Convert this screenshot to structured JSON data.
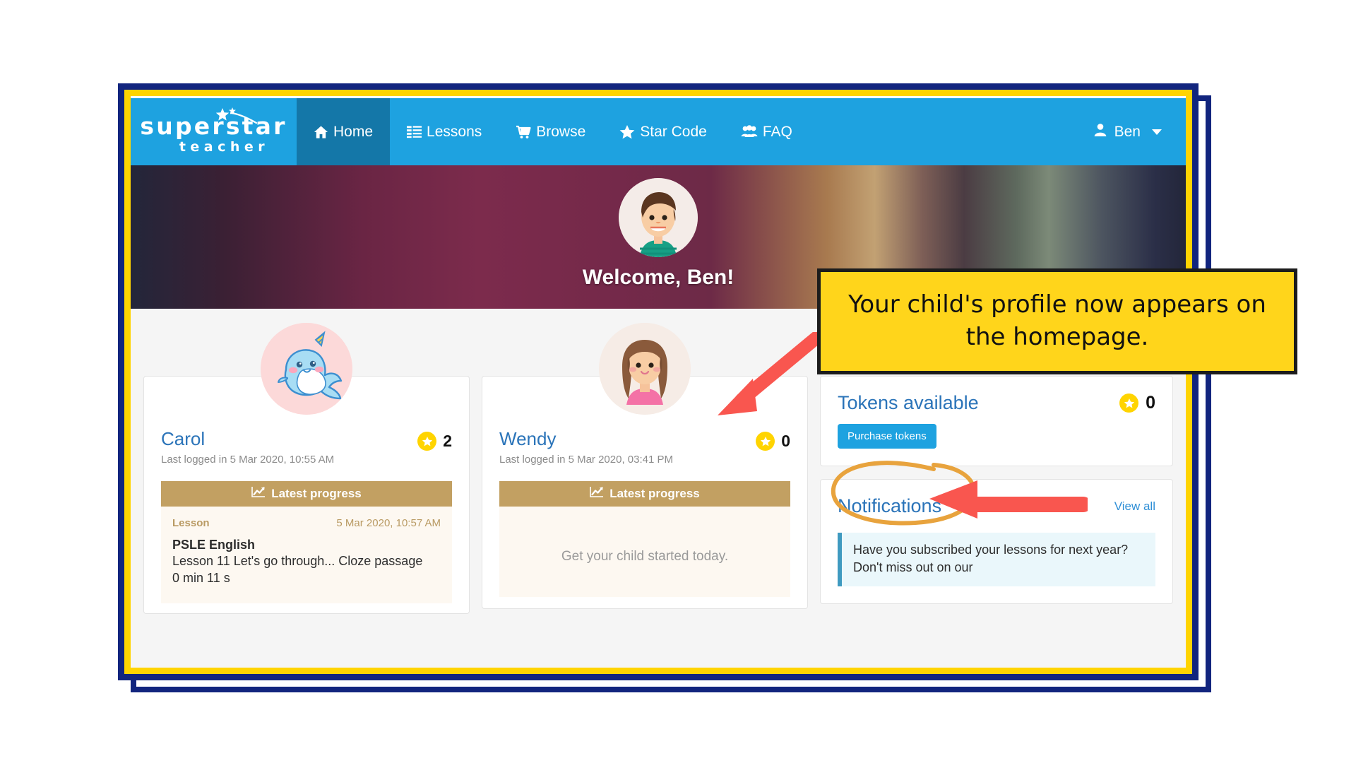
{
  "brand": {
    "line1": "superstar",
    "line2": "teacher",
    "swoosh_icon": "shooting-star-icon"
  },
  "nav": {
    "items": [
      {
        "label": "Home",
        "icon": "home-icon",
        "active": true
      },
      {
        "label": "Lessons",
        "icon": "list-icon",
        "active": false
      },
      {
        "label": "Browse",
        "icon": "cart-icon",
        "active": false
      },
      {
        "label": "Star Code",
        "icon": "star-icon",
        "active": false
      },
      {
        "label": "FAQ",
        "icon": "users-icon",
        "active": false
      }
    ],
    "user": {
      "label": "Ben",
      "icon": "user-icon",
      "caret": "chevron-down-icon"
    }
  },
  "hero": {
    "avatar_icon": "boy-avatar",
    "welcome": "Welcome, Ben!"
  },
  "children": [
    {
      "name": "Carol",
      "avatar_icon": "narwhal-avatar",
      "last_login": "Last logged in 5 Mar 2020, 10:55 AM",
      "tokens": "2",
      "progress": {
        "header": "Latest progress",
        "header_icon": "chart-line-icon",
        "label": "Lesson",
        "timestamp": "5 Mar 2020, 10:57 AM",
        "subject": "PSLE English",
        "detail": "Lesson 11 Let's go through... Cloze passage",
        "duration": "0 min 11 s",
        "empty": ""
      }
    },
    {
      "name": "Wendy",
      "avatar_icon": "girl-avatar",
      "last_login": "Last logged in 5 Mar 2020, 03:41 PM",
      "tokens": "0",
      "progress": {
        "header": "Latest progress",
        "header_icon": "chart-line-icon",
        "label": "",
        "timestamp": "",
        "subject": "",
        "detail": "",
        "duration": "",
        "empty": "Get your child started today."
      }
    }
  ],
  "tokens_panel": {
    "title": "Tokens available",
    "count": "0",
    "token_icon": "star-token-icon",
    "button_label": "Purchase tokens"
  },
  "notifications_panel": {
    "title": "Notifications",
    "view_all": "View all",
    "items": [
      {
        "text": "Have you subscribed your lessons for next year? Don't miss out on our"
      }
    ]
  },
  "annotations": {
    "callout_text": "Your child's profile now appears on the homepage.",
    "arrow_to_profile": "red-arrow-icon",
    "arrow_to_purchase": "red-arrow-icon",
    "ellipse_highlight": "orange-ellipse-icon"
  },
  "colors": {
    "nav_blue": "#1ea2e0",
    "nav_active": "#1477a8",
    "frame_navy": "#12257e",
    "frame_yellow": "#ffd400",
    "callout_yellow": "#ffd51b",
    "accent_blue": "#2b74b9",
    "progress_gold": "#c2a062",
    "annotation_red": "#f9564f",
    "annotation_orange": "#e8a33d"
  }
}
